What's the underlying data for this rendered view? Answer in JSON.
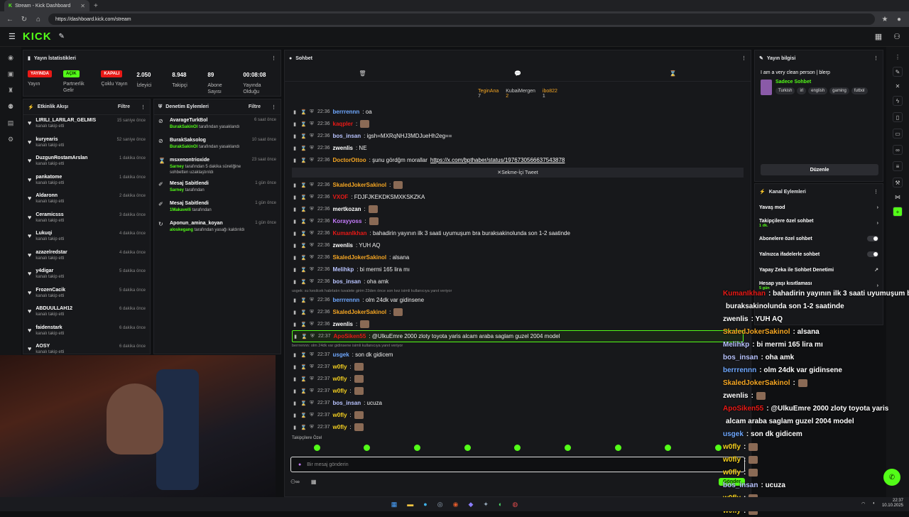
{
  "browser": {
    "tab_title": "Stream - Kick Dashboard",
    "url": "https://dashboard.kick.com/stream"
  },
  "header": {
    "logo": "KICK"
  },
  "stats": {
    "title": "Yayın İstatistikleri",
    "items": [
      {
        "badge": "YAYINDA",
        "label": "Yayın"
      },
      {
        "badge": "AÇIK",
        "label": "Partnerlik Gelir"
      },
      {
        "badge": "KAPALI",
        "label": "Çoklu Yayın"
      },
      {
        "value": "2.050",
        "label": "İzleyici"
      },
      {
        "value": "8.948",
        "label": "Takipçi"
      },
      {
        "value": "89",
        "label": "Abone Sayısı"
      },
      {
        "value": "00:08:08",
        "label": "Yayında Olduğu"
      }
    ]
  },
  "activity": {
    "title": "Etkinlik Akışı",
    "filter": "Filtre",
    "items": [
      {
        "name": "LIRILI_LARILAR_GELMIS",
        "sub": "kanalı takip etti",
        "time": "15 saniye önce"
      },
      {
        "name": "kuryearis",
        "sub": "kanalı takip etti",
        "time": "52 saniye önce"
      },
      {
        "name": "DuzgunRostamArslan",
        "sub": "kanalı takip etti",
        "time": "1 dakika önce"
      },
      {
        "name": "pankatome",
        "sub": "kanalı takip etti",
        "time": "1 dakika önce"
      },
      {
        "name": "Aldaronn",
        "sub": "kanalı takip etti",
        "time": "2 dakika önce"
      },
      {
        "name": "Ceramicsss",
        "sub": "kanalı takip etti",
        "time": "3 dakika önce"
      },
      {
        "name": "Lukuqi",
        "sub": "kanalı takip etti",
        "time": "4 dakika önce"
      },
      {
        "name": "azazelredstar",
        "sub": "kanalı takip etti",
        "time": "4 dakika önce"
      },
      {
        "name": "y4digar",
        "sub": "kanalı takip etti",
        "time": "5 dakika önce"
      },
      {
        "name": "FrozenCacik",
        "sub": "kanalı takip etti",
        "time": "5 dakika önce"
      },
      {
        "name": "ABDUULLAH12",
        "sub": "kanalı takip etti",
        "time": "6 dakika önce"
      },
      {
        "name": "faidenstark",
        "sub": "kanalı takip etti",
        "time": "6 dakika önce"
      },
      {
        "name": "AOSY",
        "sub": "kanalı takip etti",
        "time": "6 dakika önce"
      }
    ]
  },
  "moderation": {
    "title": "Denetim Eylemleri",
    "filter": "Filtre",
    "items": [
      {
        "name": "AvarageTurkBol",
        "actor": "BurakSakinOl",
        "sub": "tarafından yasaklandı",
        "time": "6 saat önce"
      },
      {
        "name": "BurakSaksolog",
        "actor": "BurakSakinOl",
        "sub": "tarafından yasaklandı",
        "time": "10 saat önce"
      },
      {
        "name": "msxenontrioxide",
        "actor": "Sarney",
        "sub": "tarafından 5 dakika süreliğine sohbetten uzaklaştırıldı",
        "time": "23 saat önce"
      },
      {
        "name": "Mesaj Sabitlendi",
        "actor": "Sarney",
        "sub": "tarafından",
        "time": "1 gün önce"
      },
      {
        "name": "Mesaj Sabitlendi",
        "actor": "1Makavelli",
        "sub": "tarafından",
        "time": "1 gün önce"
      },
      {
        "name": "Aponun_amina_koyan",
        "actor": "aloskegang",
        "sub": "tarafından yasağı kaldırıldı",
        "time": "1 gün önce"
      }
    ]
  },
  "chat": {
    "title": "Sohbet",
    "gifters": [
      {
        "name": "TeginAna",
        "count": "7"
      },
      {
        "name": "KubaiMergen",
        "count": "2"
      },
      {
        "name": "ibo822",
        "count": "1"
      }
    ],
    "tweet_label": "Sekme-İçi Tweet",
    "messages": [
      {
        "time": "22:36",
        "user": "berrrennn",
        "color": "#6fa8ff",
        "text": ": oa"
      },
      {
        "time": "22:36",
        "user": "kaqpler",
        "color": "#e91916",
        "text": ":"
      },
      {
        "time": "22:36",
        "user": "bos_insan",
        "color": "#b9c4ff",
        "text": ": igsh=MXRqNHJ3MDJueHh2eg=="
      },
      {
        "time": "22:36",
        "user": "zwenlis",
        "color": "#ffffff",
        "text": ": NE"
      },
      {
        "time": "22:36",
        "user": "DoctorOttoo",
        "color": "#f5a623",
        "text": ": şunu gördğm morallar",
        "link": "https://x.com/bpthaber/status/1976730566637543878"
      },
      {
        "time": "22:36",
        "user": "SkaledJokerSakinol",
        "color": "#f5a623",
        "text": ":"
      },
      {
        "time": "22:36",
        "user": "VXOF",
        "color": "#e91916",
        "text": ": FDJFJKEKDKSMXKSKZKA"
      },
      {
        "time": "22:36",
        "user": "mertkozan",
        "color": "#ffffff",
        "text": ":"
      },
      {
        "time": "22:36",
        "user": "Korayyoss",
        "color": "#c77dff",
        "text": ":"
      },
      {
        "time": "22:36",
        "user": "KumanIkhan",
        "color": "#e91916",
        "text": ": bahadirin yayının ilk 3 saati uyumuşum bra buraksakinolunda son 1-2 saatinde"
      },
      {
        "time": "22:36",
        "user": "zwenlis",
        "color": "#ffffff",
        "text": ": YUH AQ"
      },
      {
        "time": "22:36",
        "user": "SkaledJokerSakinol",
        "color": "#f5a623",
        "text": ": alsana"
      },
      {
        "time": "22:36",
        "user": "Melihkp",
        "color": "#b9c4ff",
        "text": ": bi mermi 165 lira mı"
      },
      {
        "time": "22:36",
        "user": "bos_insan",
        "color": "#b9c4ff",
        "text": ": oha amk"
      },
      {
        "time": "22:36",
        "user": "berrrennn",
        "color": "#6fa8ff",
        "text": ": olm 24dk var gidinsene",
        "reply": "usgek: su kesilcek habrlatın tuvalete girim 23den önce son kez isimli kullanıcıya yanıt veriyor"
      },
      {
        "time": "22:36",
        "user": "SkaledJokerSakinol",
        "color": "#f5a623",
        "text": ":"
      },
      {
        "time": "22:36",
        "user": "zwenlis",
        "color": "#ffffff",
        "text": ":"
      },
      {
        "time": "22:37",
        "user": "ApoSiken55",
        "color": "#e91916",
        "text": ": @UlkuEmre 2000 zloty toyota yaris alcam araba saglam guzel 2004 model",
        "highlight": true
      },
      {
        "time": "22:37",
        "user": "usgek",
        "color": "#6fa8ff",
        "text": ": son dk gidicem",
        "reply": "berrrennn: olm 24dk var gidinsene isimli kullanıcıya yanıt veriyor"
      },
      {
        "time": "22:37",
        "user": "w0fly",
        "color": "#f5d020",
        "text": ":"
      },
      {
        "time": "22:37",
        "user": "w0fly",
        "color": "#f5d020",
        "text": ":"
      },
      {
        "time": "22:37",
        "user": "w0fly",
        "color": "#f5d020",
        "text": ":"
      },
      {
        "time": "22:37",
        "user": "bos_insan",
        "color": "#b9c4ff",
        "text": ": ucuza"
      },
      {
        "time": "22:37",
        "user": "w0fly",
        "color": "#f5d020",
        "text": ":"
      },
      {
        "time": "22:37",
        "user": "w0fly",
        "color": "#f5d020",
        "text": ":"
      }
    ],
    "special_label": "Takipçilere Özel",
    "input_placeholder": "Bir mesaj gönderin",
    "send_label": "Gönder"
  },
  "info": {
    "title": "Yayın bilgisi",
    "stream_title": "I am a very clean person | blerp",
    "category": "Sadece Sohbet",
    "tags": [
      "Turkish",
      "irl",
      "english",
      "gaming",
      "futbol"
    ],
    "edit_label": "Düzenle"
  },
  "actions": {
    "title": "Kanal Eylemleri",
    "items": [
      {
        "label": "Yavaş mod",
        "kind": "chevron"
      },
      {
        "label": "Takipçilere özel sohbet",
        "sub": "1 dk.",
        "kind": "chevron"
      },
      {
        "label": "Abonelere özel sohbet",
        "kind": "toggle"
      },
      {
        "label": "Yalnızca ifadelerle sohbet",
        "kind": "toggle"
      },
      {
        "label": "Yapay Zeka ile Sohbet Denetimi",
        "kind": "external"
      },
      {
        "label": "Hesap yaşı kısıtlaması",
        "sub": "5 gün",
        "kind": "chevron"
      }
    ]
  },
  "overlay": {
    "lines": [
      {
        "user": "KumanIkhan",
        "color": "#e91916",
        "text": ": bahadirin yayının ilk 3 saati uyumuşum bra"
      },
      {
        "user": "",
        "color": "#ffffff",
        "text": "buraksakinolunda son 1-2 saatinde"
      },
      {
        "user": "zwenlis",
        "color": "#ffffff",
        "text": ": YUH AQ"
      },
      {
        "user": "SkaledJokerSakinol",
        "color": "#f5a623",
        "text": ": alsana"
      },
      {
        "user": "Melihkp",
        "color": "#b9c4ff",
        "text": ": bi mermi 165 lira mı"
      },
      {
        "user": "bos_insan",
        "color": "#b9c4ff",
        "text": ": oha amk"
      },
      {
        "user": "berrrennn",
        "color": "#6fa8ff",
        "text": ": olm 24dk var gidinsene"
      },
      {
        "user": "SkaledJokerSakinol",
        "color": "#f5a623",
        "text": ":"
      },
      {
        "user": "zwenlis",
        "color": "#ffffff",
        "text": ":"
      },
      {
        "user": "ApoSiken55",
        "color": "#e91916",
        "text": ": @UlkuEmre 2000 zloty toyota yaris"
      },
      {
        "user": "",
        "color": "#ffffff",
        "text": "alcam araba saglam guzel 2004 model"
      },
      {
        "user": "usgek",
        "color": "#6fa8ff",
        "text": ": son dk gidicem"
      },
      {
        "user": "w0fly",
        "color": "#f5d020",
        "text": ":"
      },
      {
        "user": "w0fly",
        "color": "#f5d020",
        "text": ":"
      },
      {
        "user": "w0fly",
        "color": "#f5d020",
        "text": ":"
      },
      {
        "user": "bos_insan",
        "color": "#b9c4ff",
        "text": ": ucuza"
      },
      {
        "user": "w0fly",
        "color": "#f5d020",
        "text": ":"
      },
      {
        "user": "w0fly",
        "color": "#f5d020",
        "text": ":"
      }
    ]
  },
  "taskbar": {
    "time": "22:37",
    "date": "10.10.2025"
  },
  "colors": {
    "accent": "#53fc18",
    "live": "#e91916"
  }
}
